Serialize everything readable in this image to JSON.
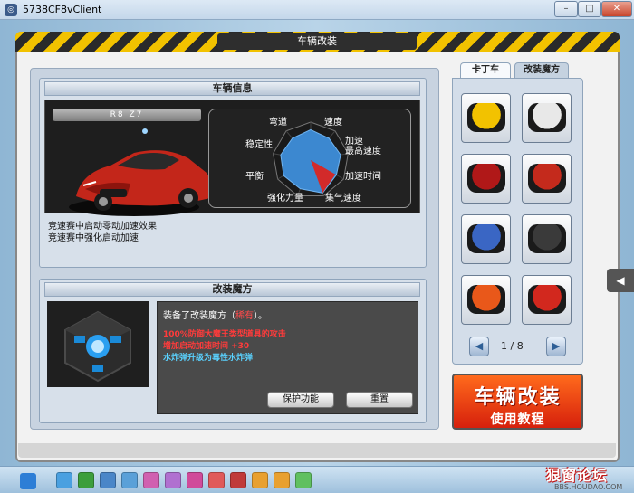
{
  "window": {
    "title": "5738CF8vClient",
    "min_glyph": "–",
    "max_glyph": "□",
    "close_glyph": "✕"
  },
  "dialog": {
    "title": "车辆改装"
  },
  "vehicle_info": {
    "header": "车辆信息",
    "car_name": "R8 Z7",
    "stats": {
      "labels": [
        "弯道",
        "速度",
        "加速",
        "最高速度",
        "加速时间",
        "集气速度",
        "强化力量",
        "平衡",
        "稳定性"
      ],
      "values": [
        0.8,
        0.75,
        0.8,
        0.78,
        0.92,
        0.8,
        0.82,
        0.8,
        0.75
      ]
    },
    "effects": [
      "竞速赛中启动零动加速效果",
      "竞速赛中强化启动加速"
    ]
  },
  "mod_cube": {
    "header": "改装魔方",
    "intro_prefix": "装备了改装魔方（",
    "intro_rarity": "稀有",
    "intro_suffix": "）。",
    "lines": [
      {
        "text": "100%防御大魔王类型道具的攻击",
        "color": "red"
      },
      {
        "text": "增加启动加速时间 +30",
        "color": "red"
      },
      {
        "text": "水炸弹升级为毒性水炸弹",
        "color": "cyan"
      }
    ],
    "protect_button": "保护功能",
    "reset_button": "重置"
  },
  "side_tabs": {
    "tab1": "卡丁车",
    "tab2": "改装魔方"
  },
  "kart_slots": [
    {
      "name": "kart-yellow",
      "color": "#f2c200"
    },
    {
      "name": "kart-white-red",
      "color": "#e8e8e8"
    },
    {
      "name": "kart-red-black-1",
      "color": "#b01818"
    },
    {
      "name": "kart-red-black-2",
      "color": "#c42a1c"
    },
    {
      "name": "kart-blue-red",
      "color": "#3a66c4"
    },
    {
      "name": "kart-black",
      "color": "#3a3a3a"
    },
    {
      "name": "kart-orange-face",
      "color": "#e9581a"
    },
    {
      "name": "kart-red-white",
      "color": "#d2281e"
    }
  ],
  "pager": {
    "text": "1 / 8",
    "prev_glyph": "◀",
    "next_glyph": "▶"
  },
  "tutorial": {
    "line1": "车辆改装",
    "line2": "使用教程"
  },
  "side_toggle_glyph": "◀",
  "watermark": {
    "text": "狠窗论坛",
    "sub": "BBS.HOUDAO.COM"
  },
  "taskbar_icons": [
    "#4aa0e0",
    "#3c9e3c",
    "#4a86c8",
    "#5aa0d8",
    "#d060b0",
    "#b070d0",
    "#d04a9a",
    "#e05a5a",
    "#c03a3a",
    "#e8a030",
    "#e8a030",
    "#60c060"
  ]
}
